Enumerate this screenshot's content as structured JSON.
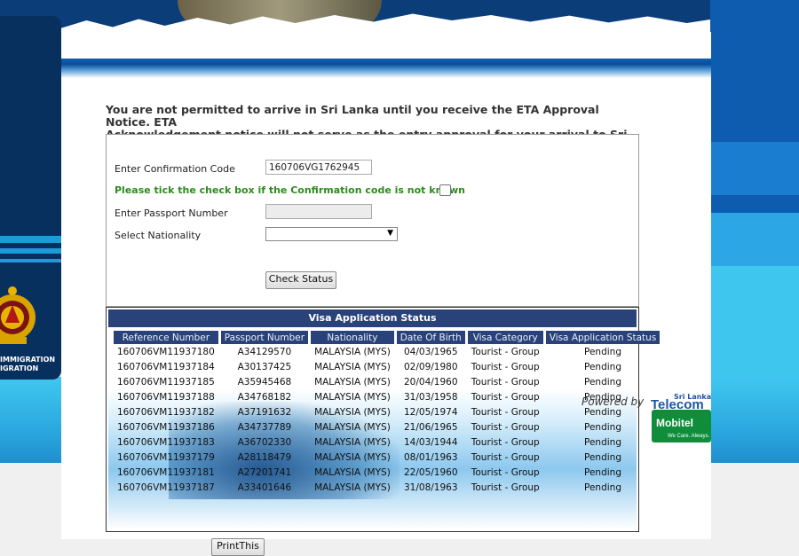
{
  "notice": {
    "line1": "You are not permitted to arrive in Sri Lanka until you receive the ETA Approval Notice. ETA",
    "line2": "Acknowledgement notice will not serve as the entry approval for your arrival to Sri Lanka."
  },
  "form": {
    "confirmation_label": "Enter Confirmation Code",
    "confirmation_value": "160706VG1762945",
    "checkbox_label": "Please tick the check box if the Confirmation code is not known",
    "checkbox_checked": false,
    "passport_label": "Enter Passport Number",
    "passport_value": "",
    "nationality_label": "Select Nationality",
    "nationality_value": "",
    "check_button": "Check Status"
  },
  "status": {
    "title": "Visa Application Status",
    "columns": [
      "Reference Number",
      "Passport Number",
      "Nationality",
      "Date Of Birth",
      "Visa Category",
      "Visa Application Status"
    ],
    "rows": [
      [
        "160706VM11937180",
        "A34129570",
        "MALAYSIA (MYS)",
        "04/03/1965",
        "Tourist - Group",
        "Pending"
      ],
      [
        "160706VM11937184",
        "A30137425",
        "MALAYSIA (MYS)",
        "02/09/1980",
        "Tourist - Group",
        "Pending"
      ],
      [
        "160706VM11937185",
        "A35945468",
        "MALAYSIA (MYS)",
        "20/04/1960",
        "Tourist - Group",
        "Pending"
      ],
      [
        "160706VM11937188",
        "A34768182",
        "MALAYSIA (MYS)",
        "31/03/1958",
        "Tourist - Group",
        "Pending"
      ],
      [
        "160706VM11937182",
        "A37191632",
        "MALAYSIA (MYS)",
        "12/05/1974",
        "Tourist - Group",
        "Pending"
      ],
      [
        "160706VM11937186",
        "A34737789",
        "MALAYSIA (MYS)",
        "21/06/1965",
        "Tourist - Group",
        "Pending"
      ],
      [
        "160706VM11937183",
        "A36702330",
        "MALAYSIA (MYS)",
        "14/03/1944",
        "Tourist - Group",
        "Pending"
      ],
      [
        "160706VM11937179",
        "A28118479",
        "MALAYSIA (MYS)",
        "08/01/1963",
        "Tourist - Group",
        "Pending"
      ],
      [
        "160706VM11937181",
        "A27201741",
        "MALAYSIA (MYS)",
        "22/05/1960",
        "Tourist - Group",
        "Pending"
      ],
      [
        "160706VM11937187",
        "A33401646",
        "MALAYSIA (MYS)",
        "31/08/1963",
        "Tourist - Group",
        "Pending"
      ]
    ],
    "print_button": "PrintThis"
  },
  "left_panel": {
    "dept_line1": "IMMIGRATION",
    "dept_line2": "IGRATION"
  },
  "powered": {
    "text": "Powered by",
    "sl": "Sri Lanka",
    "telecom": "Telecom",
    "mobitel": "Mobitel",
    "tagline": "We Care. Always."
  },
  "colors": {
    "dark_navy": "#08305f",
    "table_header": "#29427a",
    "green_label": "#2e8b1e",
    "sky_blue": "#3ec6ef"
  },
  "icons": {
    "emblem": "sri-lanka-emblem-icon",
    "dropdown": "chevron-down-icon"
  }
}
